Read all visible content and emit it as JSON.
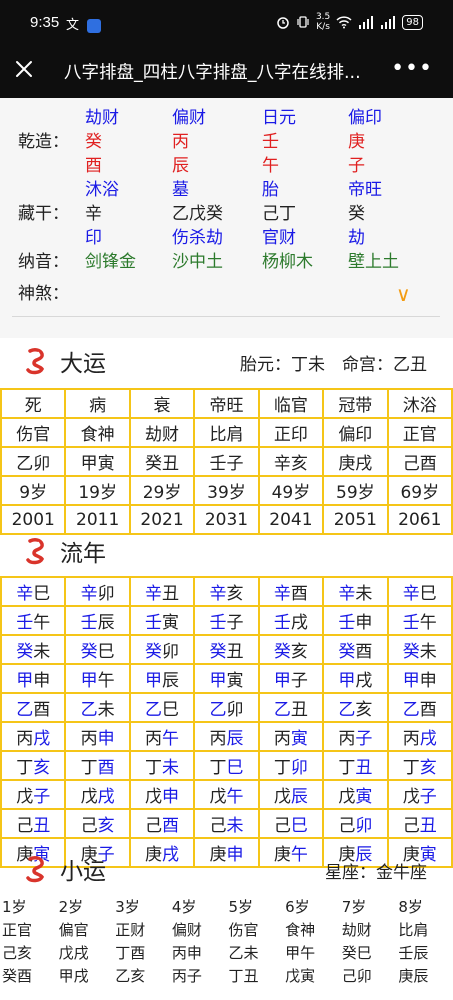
{
  "status_bar": {
    "time": "9:35",
    "left_extra": "文",
    "speed_value": "3.5",
    "speed_unit": "K/s",
    "battery": "98"
  },
  "nav": {
    "title": "八字排盘_四柱八字排盘_八字在线排...",
    "close_icon": "close-icon",
    "more_icon": "more-icon"
  },
  "chart": {
    "qianzao_label": "乾造：",
    "canggan_label": "藏干：",
    "nayin_label": "纳音：",
    "shensha_label": "神煞：",
    "shensha_toggle": "∨",
    "shishen_top": [
      "劫财",
      "偏财",
      "日元",
      "偏印"
    ],
    "tiangan": [
      "癸",
      "丙",
      "壬",
      "庚"
    ],
    "dizhi": [
      "酉",
      "辰",
      "午",
      "子"
    ],
    "changsheng": [
      "沐浴",
      "墓",
      "胎",
      "帝旺"
    ],
    "canggan": [
      "辛",
      "乙戊癸",
      "己丁",
      "癸"
    ],
    "canggan_shishen": [
      "印",
      "伤杀劫",
      "官财",
      "劫"
    ],
    "nayin": [
      "剑锋金",
      "沙中土",
      "杨柳木",
      "壁上土"
    ]
  },
  "dayun": {
    "title": "大运",
    "extra": "胎元：丁未　命宫：乙丑",
    "rows": [
      [
        "死",
        "病",
        "衰",
        "帝旺",
        "临官",
        "冠带",
        "沐浴"
      ],
      [
        "伤官",
        "食神",
        "劫财",
        "比肩",
        "正印",
        "偏印",
        "正官"
      ],
      [
        "乙卯",
        "甲寅",
        "癸丑",
        "壬子",
        "辛亥",
        "庚戌",
        "己酉"
      ],
      [
        "9岁",
        "19岁",
        "29岁",
        "39岁",
        "49岁",
        "59岁",
        "69岁"
      ],
      [
        "2001",
        "2011",
        "2021",
        "2031",
        "2041",
        "2051",
        "2061"
      ]
    ]
  },
  "liunian": {
    "title": "流年",
    "rows": [
      [
        [
          "辛",
          "巳"
        ],
        [
          "辛",
          "卯"
        ],
        [
          "辛",
          "丑"
        ],
        [
          "辛",
          "亥"
        ],
        [
          "辛",
          "酉"
        ],
        [
          "辛",
          "未"
        ],
        [
          "辛",
          "巳"
        ]
      ],
      [
        [
          "壬",
          "午"
        ],
        [
          "壬",
          "辰"
        ],
        [
          "壬",
          "寅"
        ],
        [
          "壬",
          "子"
        ],
        [
          "壬",
          "戌"
        ],
        [
          "壬",
          "申"
        ],
        [
          "壬",
          "午"
        ]
      ],
      [
        [
          "癸",
          "未"
        ],
        [
          "癸",
          "巳"
        ],
        [
          "癸",
          "卯"
        ],
        [
          "癸",
          "丑"
        ],
        [
          "癸",
          "亥"
        ],
        [
          "癸",
          "酉"
        ],
        [
          "癸",
          "未"
        ]
      ],
      [
        [
          "甲",
          "申"
        ],
        [
          "甲",
          "午"
        ],
        [
          "甲",
          "辰"
        ],
        [
          "甲",
          "寅"
        ],
        [
          "甲",
          "子"
        ],
        [
          "甲",
          "戌"
        ],
        [
          "甲",
          "申"
        ]
      ],
      [
        [
          "乙",
          "酉"
        ],
        [
          "乙",
          "未"
        ],
        [
          "乙",
          "巳"
        ],
        [
          "乙",
          "卯"
        ],
        [
          "乙",
          "丑"
        ],
        [
          "乙",
          "亥"
        ],
        [
          "乙",
          "酉"
        ]
      ],
      [
        [
          "丙",
          "戌"
        ],
        [
          "丙",
          "申"
        ],
        [
          "丙",
          "午"
        ],
        [
          "丙",
          "辰"
        ],
        [
          "丙",
          "寅"
        ],
        [
          "丙",
          "子"
        ],
        [
          "丙",
          "戌"
        ]
      ],
      [
        [
          "丁",
          "亥"
        ],
        [
          "丁",
          "酉"
        ],
        [
          "丁",
          "未"
        ],
        [
          "丁",
          "巳"
        ],
        [
          "丁",
          "卯"
        ],
        [
          "丁",
          "丑"
        ],
        [
          "丁",
          "亥"
        ]
      ],
      [
        [
          "戊",
          "子"
        ],
        [
          "戊",
          "戌"
        ],
        [
          "戊",
          "申"
        ],
        [
          "戊",
          "午"
        ],
        [
          "戊",
          "辰"
        ],
        [
          "戊",
          "寅"
        ],
        [
          "戊",
          "子"
        ]
      ],
      [
        [
          "己",
          "丑"
        ],
        [
          "己",
          "亥"
        ],
        [
          "己",
          "酉"
        ],
        [
          "己",
          "未"
        ],
        [
          "己",
          "巳"
        ],
        [
          "己",
          "卯"
        ],
        [
          "己",
          "丑"
        ]
      ],
      [
        [
          "庚",
          "寅"
        ],
        [
          "庚",
          "子"
        ],
        [
          "庚",
          "戌"
        ],
        [
          "庚",
          "申"
        ],
        [
          "庚",
          "午"
        ],
        [
          "庚",
          "辰"
        ],
        [
          "庚",
          "寅"
        ]
      ]
    ],
    "blue_first_rows": [
      0,
      1,
      2,
      3,
      4
    ],
    "blue_second_rows": [
      5,
      6,
      7,
      8,
      9
    ]
  },
  "xiaoyun": {
    "title": "小运",
    "extra": "星座：金牛座",
    "rows": [
      [
        "1岁",
        "2岁",
        "3岁",
        "4岁",
        "5岁",
        "6岁",
        "7岁",
        "8岁"
      ],
      [
        "正官",
        "偏官",
        "正财",
        "偏财",
        "伤官",
        "食神",
        "劫财",
        "比肩"
      ],
      [
        "己亥",
        "戊戌",
        "丁酉",
        "丙申",
        "乙未",
        "甲午",
        "癸巳",
        "壬辰"
      ],
      [
        "癸酉",
        "甲戌",
        "乙亥",
        "丙子",
        "丁丑",
        "戊寅",
        "己卯",
        "庚辰"
      ]
    ]
  },
  "colors": {
    "grid_border": "#f5c518",
    "blue": "#1a1ae6",
    "red": "#e02020",
    "green": "#2c7a2c",
    "dragon": "#d9342b"
  }
}
